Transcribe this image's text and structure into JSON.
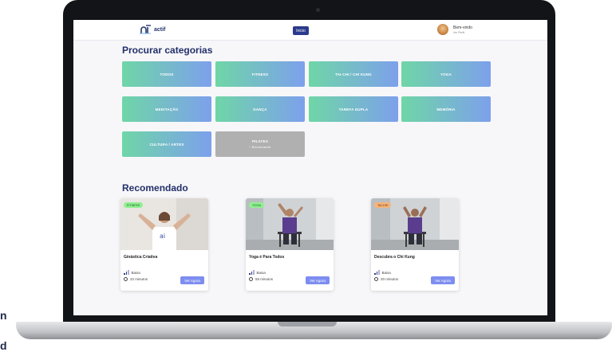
{
  "header": {
    "logo_text": "actif",
    "nav_button": "Inicio",
    "user_greeting": "Bem-vindo",
    "user_profile_link": "Ver Perfil"
  },
  "categories": {
    "title": "Procurar categorias",
    "items": [
      {
        "label": "TODOS"
      },
      {
        "label": "FITNESS"
      },
      {
        "label": "TAI-CHI / CHI KUNG"
      },
      {
        "label": "YOGA"
      },
      {
        "label": "MEDITAÇÃO"
      },
      {
        "label": "DANÇA"
      },
      {
        "label": "TAREFA DUPLA"
      },
      {
        "label": "MEMÓRIA"
      },
      {
        "label": "CULTURA / ARTES"
      },
      {
        "label": "PILATES",
        "sub": "* Brevemente"
      }
    ]
  },
  "recommended": {
    "title": "Recomendado",
    "cards": [
      {
        "badge": "FITNESS",
        "badge_color": "#8ff08f",
        "title": "Ginástica Criativa",
        "level": "Baixa",
        "duration": "22 minutos",
        "button": "Ver Agora"
      },
      {
        "badge": "YOGA",
        "badge_color": "#8ff08f",
        "title": "Yoga é Para Todos",
        "level": "Baixa",
        "duration": "55 minutos",
        "button": "Ver Agora"
      },
      {
        "badge": "TAI-CHI",
        "badge_color": "#f6b37a",
        "title": "Descubra o Chi Kung",
        "level": "Baixa",
        "duration": "20 minutos",
        "button": "Ver Agora"
      }
    ]
  },
  "background_text": {
    "line1": "n",
    "line2": "d"
  },
  "colors": {
    "accent": "#2b3a8c",
    "title": "#23306a",
    "gradient_start": "#6fd6a7",
    "gradient_end": "#7da0ec"
  }
}
